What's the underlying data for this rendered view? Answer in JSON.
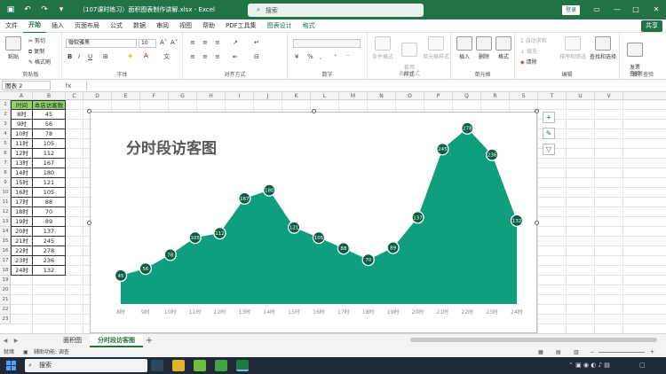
{
  "window": {
    "doc_title": "（107课时练习）面积图表制作讲解.xlsx  -  Excel",
    "search_placeholder": "搜索",
    "login_label": "登录",
    "share_label": "共享"
  },
  "menu": {
    "tabs": [
      "文件",
      "开始",
      "插入",
      "页面布局",
      "公式",
      "数据",
      "审阅",
      "视图",
      "帮助",
      "PDF工具集",
      "图表设计",
      "格式"
    ],
    "active": "开始"
  },
  "ribbon": {
    "groups": {
      "clipboard": "剪贴板",
      "font": "字体",
      "alignment": "对齐方式",
      "number": "数字",
      "styles": "样式",
      "cells": "单元格",
      "editing": "编辑",
      "invoice": "发票查验"
    },
    "paste_label": "粘贴",
    "cut_label": "剪切",
    "copy_label": "复制",
    "format_painter_label": "格式刷",
    "font_name": "微软雅黑",
    "font_size": "10",
    "cond_format_label": "条件格式",
    "table_format_label": "套用\n表格格式",
    "cell_style_label": "单元格样式",
    "insert_label": "插入",
    "delete_label": "删除",
    "format_label": "格式",
    "autosum_label": "自动求和",
    "fill_label": "填充",
    "clear_label": "清除",
    "sort_filter_label": "排序和筛选",
    "find_select_label": "查找和选择",
    "invoice_btn_label": "发票\n查验"
  },
  "formula_bar": {
    "name_box": "图表 2",
    "fx": "fx",
    "value": ""
  },
  "sheet": {
    "columns": [
      "A",
      "B",
      "C",
      "D",
      "E",
      "F",
      "G",
      "H",
      "I",
      "J",
      "K",
      "L",
      "M",
      "N",
      "O",
      "P",
      "Q",
      "R",
      "S",
      "T",
      "U",
      "V"
    ],
    "rows": [
      "1",
      "2",
      "3",
      "4",
      "5",
      "6",
      "7",
      "8",
      "9",
      "10",
      "11",
      "12",
      "13",
      "14",
      "15",
      "16",
      "17",
      "18",
      "19",
      "20",
      "21",
      "22",
      "23"
    ],
    "headers": [
      "时间",
      "本店访客数"
    ],
    "data": [
      [
        "8时",
        "45"
      ],
      [
        "9时",
        "56"
      ],
      [
        "10时",
        "78"
      ],
      [
        "11时",
        "105"
      ],
      [
        "12时",
        "112"
      ],
      [
        "13时",
        "167"
      ],
      [
        "14时",
        "180"
      ],
      [
        "15时",
        "121"
      ],
      [
        "16时",
        "105"
      ],
      [
        "17时",
        "88"
      ],
      [
        "18时",
        "70"
      ],
      [
        "19时",
        "89"
      ],
      [
        "20时",
        "137"
      ],
      [
        "21时",
        "245"
      ],
      [
        "22时",
        "278"
      ],
      [
        "23时",
        "236"
      ],
      [
        "24时",
        "132"
      ]
    ]
  },
  "chart_data": {
    "type": "area",
    "title": "分时段访客图",
    "categories": [
      "8时",
      "9时",
      "10时",
      "11时",
      "12时",
      "13时",
      "14时",
      "15时",
      "16时",
      "17时",
      "18时",
      "19时",
      "20时",
      "21时",
      "22时",
      "23时",
      "24时"
    ],
    "series": [
      {
        "values": [
          45,
          56,
          78,
          105,
          112,
          167,
          180,
          121,
          105,
          88,
          70,
          89,
          137,
          245,
          278,
          236,
          132
        ]
      }
    ],
    "ylim": [
      0,
      300
    ],
    "grid": false,
    "legend": "none",
    "data_labels": true,
    "fill_color": "#0f9e7e",
    "marker_color": "#0d5c48"
  },
  "sheet_tabs": {
    "tabs": [
      "面积图",
      "分时段访客图"
    ],
    "active": "分时段访客图",
    "add": "+"
  },
  "status": {
    "ready": "就绪",
    "accessibility": "辅助功能: 调查"
  },
  "taskbar": {
    "search": "搜索"
  }
}
